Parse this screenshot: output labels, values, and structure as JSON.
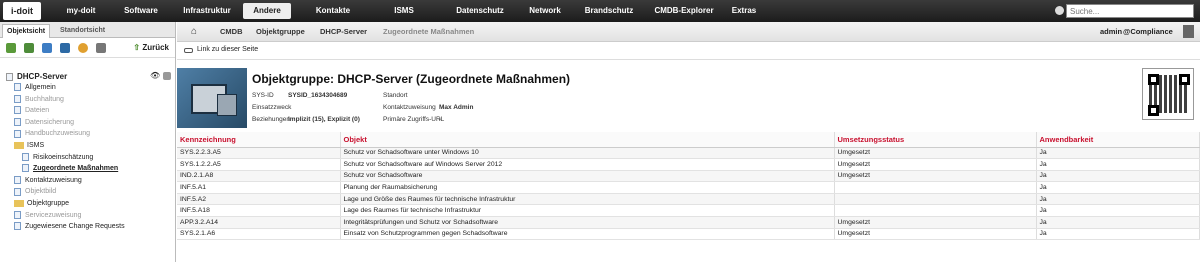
{
  "topnav": {
    "logo": "i-doit",
    "items": [
      "my-doit",
      "Software",
      "Infrastruktur",
      "Andere",
      "Kontakte",
      "ISMS",
      "Datenschutz",
      "Network",
      "Brandschutz",
      "CMDB-Explorer",
      "Extras"
    ],
    "active": "Andere",
    "search_placeholder": "Suche..."
  },
  "sidebar": {
    "tabs": [
      "Objektsicht",
      "Standortsicht"
    ],
    "back_label": "Zurück",
    "root": "DHCP-Server",
    "items": [
      {
        "label": "Allgemein",
        "state": "normal"
      },
      {
        "label": "Buchhaltung",
        "state": "gray"
      },
      {
        "label": "Dateien",
        "state": "gray"
      },
      {
        "label": "Datensicherung",
        "state": "gray"
      },
      {
        "label": "Handbuchzuweisung",
        "state": "gray"
      },
      {
        "label": "ISMS",
        "state": "folder"
      },
      {
        "label": "Risikoeinschätzung",
        "state": "child"
      },
      {
        "label": "Zugeordnete Maßnahmen",
        "state": "child-active"
      },
      {
        "label": "Kontaktzuweisung",
        "state": "normal"
      },
      {
        "label": "Objektbild",
        "state": "gray"
      },
      {
        "label": "Objektgruppe",
        "state": "folder"
      },
      {
        "label": "Servicezuweisung",
        "state": "gray"
      },
      {
        "label": "Zugewiesene Change Requests",
        "state": "normal"
      }
    ]
  },
  "breadcrumb": [
    "CMDB",
    "Objektgruppe",
    "DHCP-Server",
    "Zugeordnete Maßnahmen"
  ],
  "user": {
    "name": "admin",
    "tenant": "@Compliance"
  },
  "link_label": "Link zu dieser Seite",
  "object": {
    "title": "Objektgruppe: DHCP-Server (Zugeordnete Maßnahmen)",
    "attrs_left": [
      {
        "k": "SYS-ID",
        "v": "SYSID_1634304689"
      },
      {
        "k": "Einsatzzweck",
        "v": ""
      },
      {
        "k": "Beziehungen",
        "v": "Implizit (15), Explizit (0)"
      }
    ],
    "attrs_right": [
      {
        "k": "Standort",
        "v": ""
      },
      {
        "k": "Kontaktzuweisung",
        "v": "Max Admin"
      },
      {
        "k": "Primäre Zugriffs-URL",
        "v": "-"
      }
    ]
  },
  "table": {
    "headers": [
      "Kennzeichnung",
      "Objekt",
      "Umsetzungsstatus",
      "Anwendbarkeit"
    ],
    "rows": [
      [
        "SYS.2.2.3.A5",
        "Schutz vor Schadsoftware unter Windows 10",
        "Umgesetzt",
        "Ja"
      ],
      [
        "SYS.1.2.2.A5",
        "Schutz vor Schadsoftware auf Windows Server 2012",
        "Umgesetzt",
        "Ja"
      ],
      [
        "IND.2.1.A8",
        "Schutz vor Schadsoftware",
        "Umgesetzt",
        "Ja"
      ],
      [
        "INF.5.A1",
        "Planung der Raumabsicherung",
        "",
        "Ja"
      ],
      [
        "INF.5.A2",
        "Lage und Größe des Raumes für technische Infrastruktur",
        "",
        "Ja"
      ],
      [
        "INF.5.A18",
        "Lage des Raumes für technische Infrastruktur",
        "",
        "Ja"
      ],
      [
        "APP.3.2.A14",
        "Integritätsprüfungen und Schutz vor Schadsoftware",
        "Umgesetzt",
        "Ja"
      ],
      [
        "SYS.2.1.A6",
        "Einsatz von Schutzprogrammen gegen Schadsoftware",
        "Umgesetzt",
        "Ja"
      ]
    ]
  }
}
